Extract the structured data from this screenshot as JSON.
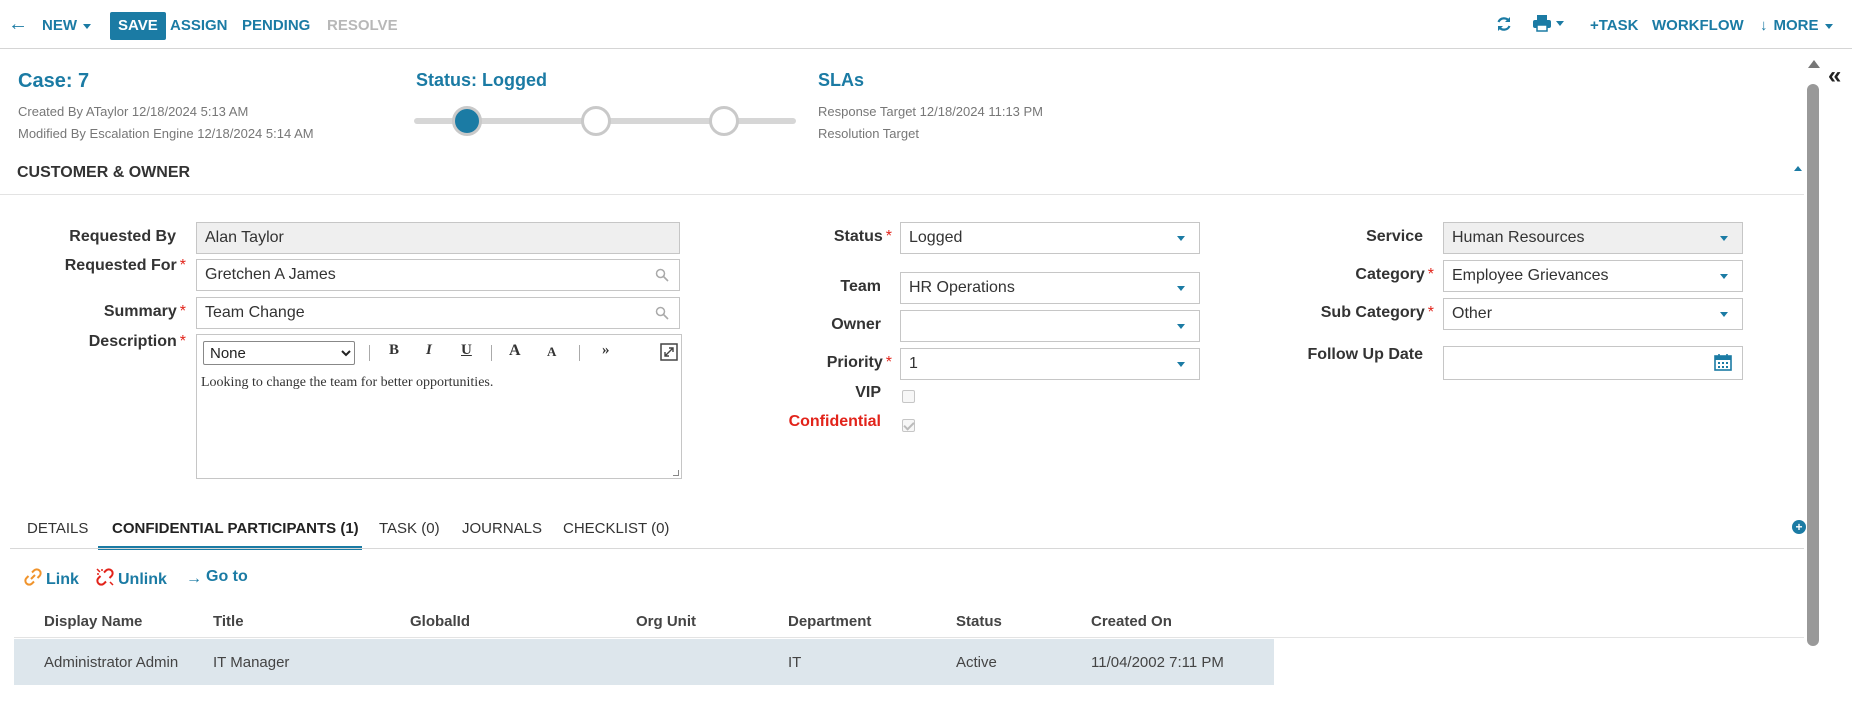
{
  "toolbar": {
    "back": "←",
    "new": "NEW",
    "save": "SAVE",
    "assign": "ASSIGN",
    "pending": "PENDING",
    "resolve": "RESOLVE",
    "add_task": "+TASK",
    "workflow": "WORKFLOW",
    "more": "MORE"
  },
  "header": {
    "case": "Case: 7",
    "created": "Created By ATaylor 12/18/2024 5:13 AM",
    "modified": "Modified By Escalation Engine 12/18/2024 5:14 AM",
    "status": "Status: Logged",
    "slas_title": "SLAs",
    "response_target": "Response Target 12/18/2024 11:13 PM",
    "resolution_target": "Resolution Target"
  },
  "section": {
    "title": "CUSTOMER & OWNER"
  },
  "form": {
    "requested_by_label": "Requested By",
    "requested_by": "Alan Taylor",
    "requested_for_label": "Requested For",
    "requested_for": "Gretchen A James",
    "summary_label": "Summary",
    "summary": "Team Change",
    "description_label": "Description",
    "format_option": "None",
    "description": "Looking to change the team for better opportunities.",
    "status_label": "Status",
    "status": "Logged",
    "team_label": "Team",
    "team": "HR Operations",
    "owner_label": "Owner",
    "owner": "",
    "priority_label": "Priority",
    "priority": "1",
    "vip_label": "VIP",
    "confidential_label": "Confidential",
    "service_label": "Service",
    "service": "Human Resources",
    "category_label": "Category",
    "category": "Employee Grievances",
    "subcategory_label": "Sub Category",
    "subcategory": "Other",
    "followup_label": "Follow Up Date",
    "followup": ""
  },
  "editor_buttons": {
    "bold": "B",
    "italic": "I",
    "underline": "U",
    "font_up": "A",
    "font_down": "A",
    "more": "»"
  },
  "tabs": [
    "DETAILS",
    "CONFIDENTIAL PARTICIPANTS (1)",
    "TASK (0)",
    "JOURNALS",
    "CHECKLIST (0)"
  ],
  "actions": {
    "link": "Link",
    "unlink": "Unlink",
    "goto": "Go to"
  },
  "table": {
    "headers": [
      "Display Name",
      "Title",
      "GlobalId",
      "Org Unit",
      "Department",
      "Status",
      "Created On"
    ],
    "rows": [
      [
        "Administrator Admin",
        "IT Manager",
        "",
        "",
        "IT",
        "Active",
        "11/04/2002 7:11 PM"
      ]
    ]
  },
  "colors": {
    "accent": "#1b7ba4",
    "required": "#e2231a",
    "row_selected": "#dde6ec"
  }
}
